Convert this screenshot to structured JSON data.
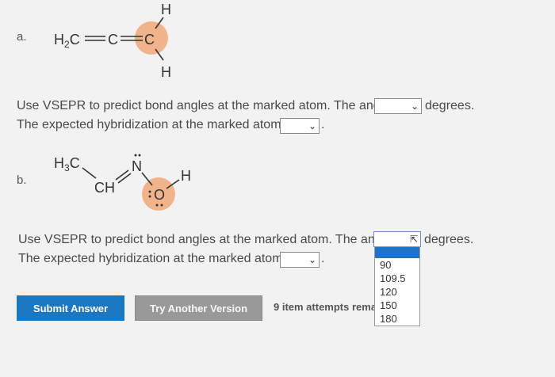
{
  "part_a": {
    "letter": "a.",
    "molecule": {
      "left_group": "H₂C",
      "center_atom": "C",
      "marked_atom": "C",
      "top_atom": "H",
      "bottom_atom": "H"
    },
    "angle_prompt": "Use VSEPR to predict bond angles at the marked atom. The angle is :",
    "angle_selected": "",
    "angle_unit": "degrees.",
    "hyb_prompt": "The expected hybridization at the marked atom is",
    "hyb_selected": ""
  },
  "part_b": {
    "letter": "b.",
    "molecule": {
      "methyl": "H₃C",
      "ch": "CH",
      "nitrogen": "N",
      "marked_atom": "O",
      "hydrogen": "H"
    },
    "angle_prompt": "Use VSEPR to predict bond angles at the marked atom. The angle is :",
    "angle_selected": "",
    "angle_unit": "degrees.",
    "hyb_prompt": "The expected hybridization at the marked atom is",
    "hyb_selected": "",
    "angle_options": [
      "",
      "90",
      "109.5",
      "120",
      "150",
      "180"
    ]
  },
  "actions": {
    "submit_label": "Submit Answer",
    "try_label": "Try Another Version",
    "attempts_text": "9 item attempts rema"
  },
  "colors": {
    "marked_highlight": "#f0a878",
    "submit_bg": "#1a78c2",
    "try_bg": "#999999",
    "option_highlight": "#1e72c8"
  }
}
